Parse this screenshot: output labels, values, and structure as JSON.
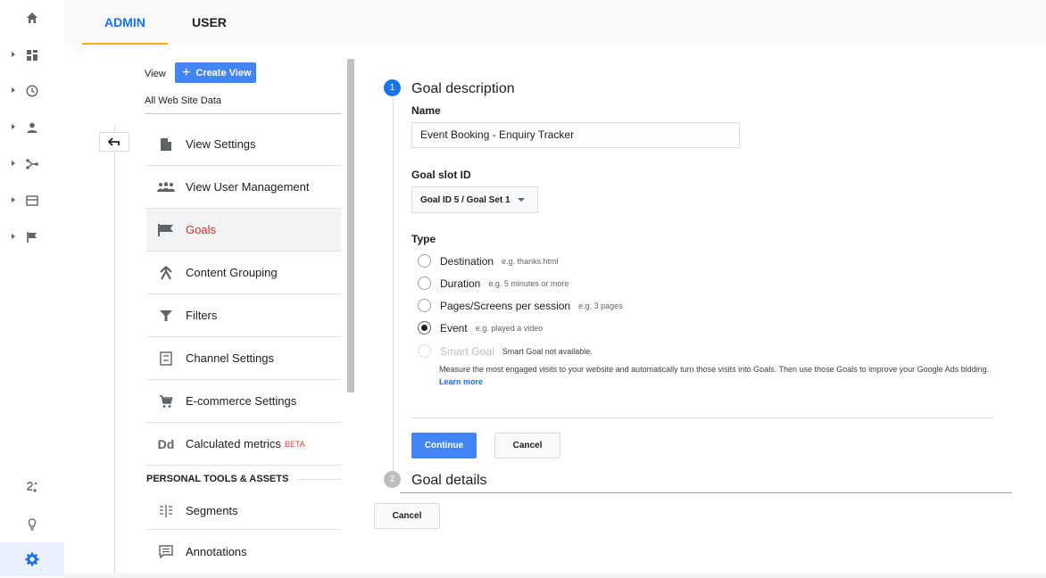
{
  "tabs": {
    "admin": "ADMIN",
    "user": "USER"
  },
  "rail": {
    "items": [
      "home-icon",
      "dashboard-icon",
      "clock-icon",
      "person-icon",
      "acquisition-icon",
      "behavior-icon",
      "flag-icon"
    ],
    "bottom": [
      "attribution-icon",
      "lightbulb-icon",
      "gear-icon"
    ]
  },
  "view": {
    "label": "View",
    "create_button": "Create View",
    "create_plus": "+",
    "name": "All Web Site Data"
  },
  "menu": {
    "items": [
      {
        "label": "View Settings",
        "icon": "document-icon"
      },
      {
        "label": "View User Management",
        "icon": "people-icon"
      },
      {
        "label": "Goals",
        "icon": "flag-icon"
      },
      {
        "label": "Content Grouping",
        "icon": "grouping-icon"
      },
      {
        "label": "Filters",
        "icon": "filter-icon"
      },
      {
        "label": "Channel Settings",
        "icon": "channel-icon"
      },
      {
        "label": "E-commerce Settings",
        "icon": "cart-icon"
      },
      {
        "label": "Calculated metrics",
        "icon": "dd-icon",
        "badge": "BETA",
        "icon_text": "Dd"
      }
    ],
    "section_title": "PERSONAL TOOLS & ASSETS",
    "section_items": [
      {
        "label": "Segments",
        "icon": "segments-icon"
      },
      {
        "label": "Annotations",
        "icon": "annotation-icon"
      }
    ]
  },
  "form": {
    "step1": {
      "number": "1",
      "title": "Goal description"
    },
    "name_label": "Name",
    "name_value": "Event Booking - Enquiry Tracker",
    "slot_label": "Goal slot ID",
    "slot_value": "Goal ID 5 / Goal Set 1",
    "type_label": "Type",
    "types": [
      {
        "label": "Destination",
        "hint": "e.g. thanks.html"
      },
      {
        "label": "Duration",
        "hint": "e.g. 5 minutes or more"
      },
      {
        "label": "Pages/Screens per session",
        "hint": "e.g. 3 pages"
      },
      {
        "label": "Event",
        "hint": "e.g. played a video"
      },
      {
        "label": "Smart Goal",
        "hint": "Smart Goal not available."
      }
    ],
    "selected_type": "Event",
    "smart_desc": "Measure the most engaged visits to your website and automatically turn those visits into Goals. Then use those Goals to improve your Google Ads bidding.",
    "learn_more": "Learn more",
    "continue_label": "Continue",
    "cancel_label": "Cancel",
    "step2": {
      "number": "2",
      "title": "Goal details"
    },
    "outer_cancel_label": "Cancel"
  },
  "colors": {
    "accent": "#1a73e8",
    "button_blue": "#4285f4",
    "tab_underline": "#f4b400",
    "selected_text": "#d93025"
  }
}
